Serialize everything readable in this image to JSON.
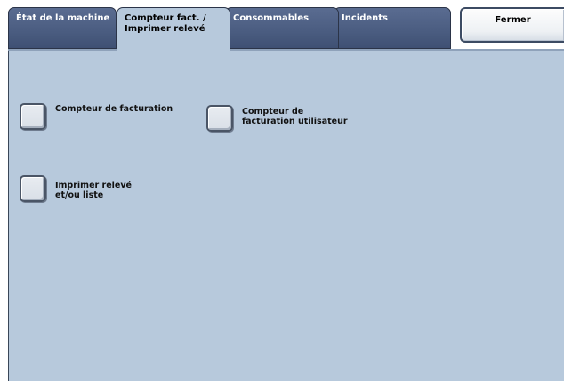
{
  "tabs": [
    {
      "label": "État de la machine",
      "active": false
    },
    {
      "label": "Compteur fact. /\nImprimer relevé",
      "active": true
    },
    {
      "label": "Consommables",
      "active": false
    },
    {
      "label": "Incidents",
      "active": false
    }
  ],
  "close_button": {
    "label": "Fermer"
  },
  "options": {
    "billing_meter": "Compteur de facturation",
    "user_billing_meter": "Compteur de\nfacturation utilisateur",
    "print_report": "Imprimer relevé\net/ou liste"
  },
  "colors": {
    "panel_background": "#b7c9dc",
    "inactive_tab": "#4a5c80"
  }
}
